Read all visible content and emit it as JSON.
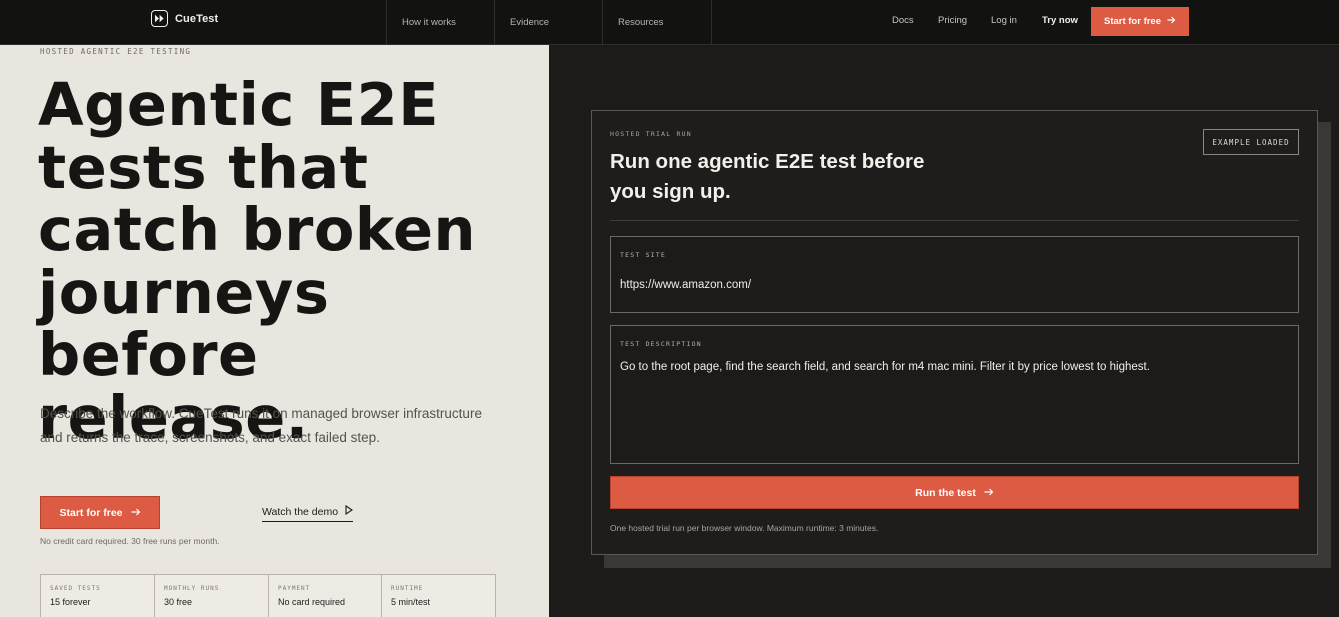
{
  "nav": {
    "brand": "CueTest",
    "columns": [
      "How it works",
      "Evidence",
      "Resources"
    ],
    "links": [
      "Docs",
      "Pricing",
      "Log in",
      "Try now"
    ],
    "cta": "Start for free"
  },
  "hero": {
    "eyebrow": "HOSTED AGENTIC E2E TESTING",
    "headline_lines": [
      "Agentic E2E",
      "tests that",
      "catch broken",
      "journeys",
      "before release."
    ],
    "subtext": "Describe the workflow. CueTest runs it on managed browser infrastructure and returns the trace, screenshots, and exact failed step.",
    "primary_cta": "Start for free",
    "secondary_cta": "Watch the demo",
    "fineprint": "No credit card required. 30 free runs per month.",
    "stats": [
      {
        "label": "SAVED TESTS",
        "value": "15 forever"
      },
      {
        "label": "MONTHLY RUNS",
        "value": "30 free"
      },
      {
        "label": "PAYMENT",
        "value": "No card required"
      },
      {
        "label": "RUNTIME",
        "value": "5 min/test"
      }
    ]
  },
  "trial": {
    "eyebrow": "HOSTED TRIAL RUN",
    "title": "Run one agentic E2E test before you sign up.",
    "badge": "EXAMPLE LOADED",
    "site_label": "TEST SITE",
    "site_value": "https://www.amazon.com/",
    "desc_label": "TEST DESCRIPTION",
    "desc_value": "Go to the root page, find the search field, and search for m4 mac mini. Filter it by price lowest to highest.",
    "run_label": "Run the test",
    "note": "One hosted trial run per browser window. Maximum runtime: 3 minutes."
  },
  "colors": {
    "accent": "#dc5b42",
    "nav_bg": "#121211",
    "hero_bg": "#e9e6e0",
    "dark_bg": "#1c1b19"
  },
  "icons": {
    "brand": "fast-forward-icon",
    "cta_arrow": "arrow-right-icon",
    "demo": "play-icon"
  }
}
